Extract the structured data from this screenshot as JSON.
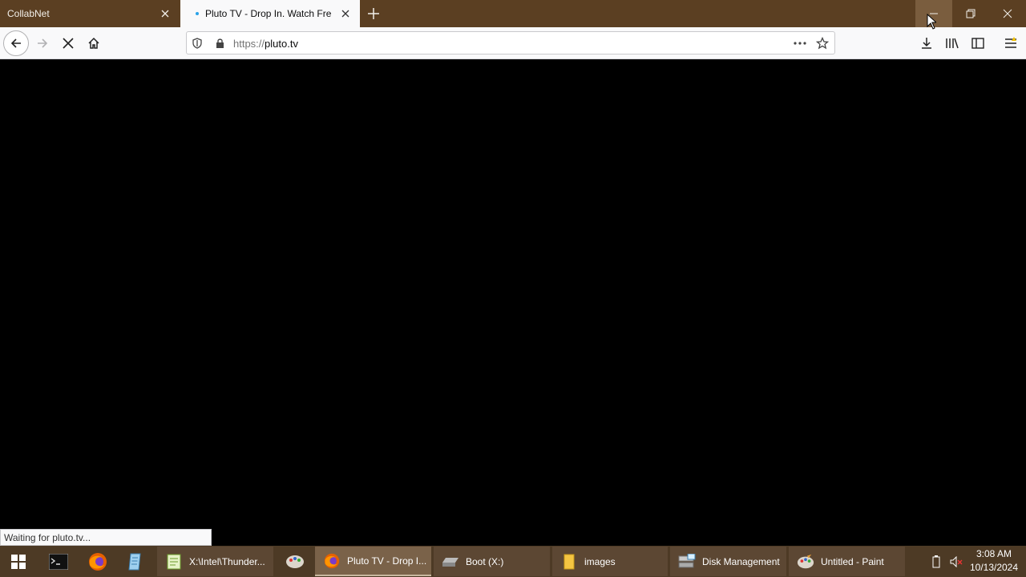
{
  "tabs": [
    {
      "title": "CollabNet",
      "active": false
    },
    {
      "title": "Pluto TV - Drop In. Watch Free.",
      "active": true,
      "loading": true
    }
  ],
  "urlbar": {
    "scheme": "https://",
    "host": "pluto.tv"
  },
  "status_text": "Waiting for pluto.tv...",
  "taskbar": {
    "items": [
      {
        "label": "X:\\Intel\\Thunder...",
        "icon": "notepad-icon"
      },
      {
        "label": "Pluto TV - Drop I...",
        "icon": "firefox-icon",
        "active": true
      },
      {
        "label": "Boot (X:)",
        "icon": "drive-icon"
      },
      {
        "label": "images",
        "icon": "folder-icon"
      },
      {
        "label": "Disk Management",
        "icon": "disk-management-icon"
      },
      {
        "label": "Untitled - Paint",
        "icon": "paint-icon"
      }
    ],
    "clock_time": "3:08 AM",
    "clock_date": "10/13/2024"
  },
  "colors": {
    "titlebar": "#5b3f22",
    "taskbar": "#4d3a25",
    "accent_dot": "#2aa3e8"
  }
}
